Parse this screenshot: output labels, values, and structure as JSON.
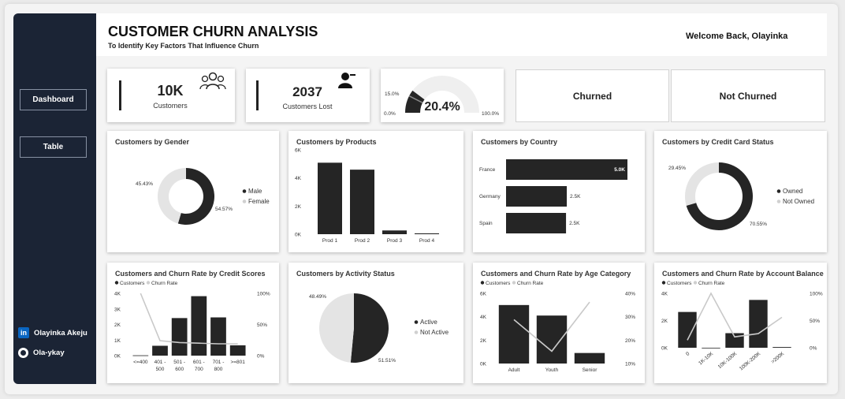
{
  "header": {
    "title": "CUSTOMER CHURN ANALYSIS",
    "subtitle": "To Identify Key Factors That Influence Churn",
    "welcome": "Welcome Back, Olayinka"
  },
  "sidebar": {
    "nav": [
      {
        "label": "Dashboard"
      },
      {
        "label": "Table"
      }
    ],
    "links": [
      {
        "icon": "linkedin-icon",
        "label": "Olayinka Akeju"
      },
      {
        "icon": "github-icon",
        "label": "Ola-ykay"
      }
    ]
  },
  "kpis": {
    "customers": {
      "value": "10K",
      "label": "Customers"
    },
    "lost": {
      "value": "2037",
      "label": "Customers Lost"
    },
    "gauge": {
      "value": "20.4%",
      "min": "0.0%",
      "max": "100.0%",
      "target": "15.0%",
      "fraction": 0.204,
      "target_fraction": 0.15
    }
  },
  "slicers": {
    "churned": "Churned",
    "not_churned": "Not Churned"
  },
  "colors": {
    "primary": "#252525",
    "light": "#e4e4e4",
    "line": "#c9c9c9",
    "sidebar": "#1b2435"
  },
  "chart_data": [
    {
      "id": "gender",
      "type": "pie",
      "title": "Customers by Gender",
      "legend": [
        "Male",
        "Female"
      ],
      "values": [
        54.57,
        45.43
      ],
      "labels": [
        "54.57%",
        "45.43%"
      ]
    },
    {
      "id": "products",
      "type": "bar",
      "title": "Customers by Products",
      "categories": [
        "Prod 1",
        "Prod 2",
        "Prod 3",
        "Prod 4"
      ],
      "values": [
        5084,
        4590,
        266,
        60
      ],
      "yticks": [
        "6K",
        "4K",
        "2K",
        "0K"
      ],
      "ylim": [
        0,
        6000
      ]
    },
    {
      "id": "country",
      "type": "bar",
      "title": "Customers by Country",
      "categories": [
        "France",
        "Germany",
        "Spain"
      ],
      "values": [
        5014,
        2509,
        2477
      ],
      "labels": [
        "5.0K",
        "2.5K",
        "2.5K"
      ]
    },
    {
      "id": "credit_card",
      "type": "pie",
      "title": "Customers by Credit Card Status",
      "legend": [
        "Owned",
        "Not Owned"
      ],
      "values": [
        70.55,
        29.45
      ],
      "labels": [
        "70.55%",
        "29.45%"
      ]
    },
    {
      "id": "credit_scores",
      "type": "bar",
      "title": "Customers and Churn Rate by Credit Scores",
      "legend": [
        "Customers",
        "Churn Rate"
      ],
      "categories": [
        "<=400",
        "401 - 500",
        "501 - 600",
        "601 - 700",
        "701 - 800",
        ">=801"
      ],
      "values": [
        19,
        633,
        2412,
        3818,
        2455,
        663
      ],
      "churn_rate": [
        100,
        24,
        21,
        20,
        19,
        19
      ],
      "yticks": [
        "4K",
        "3K",
        "2K",
        "1K",
        "0K"
      ],
      "ylim": [
        0,
        4000
      ],
      "y2ticks": [
        "100%",
        "50%",
        "0%"
      ]
    },
    {
      "id": "activity",
      "type": "pie",
      "title": "Customers by Activity Status",
      "legend": [
        "Active",
        "Not Active"
      ],
      "values": [
        51.51,
        48.49
      ],
      "labels": [
        "51.51%",
        "48.49%"
      ]
    },
    {
      "id": "age",
      "type": "bar",
      "title": "Customers and Churn Rate by Age Category",
      "legend": [
        "Customers",
        "Churn Rate"
      ],
      "categories": [
        "Adult",
        "Youth",
        "Senior"
      ],
      "values": [
        5000,
        4100,
        900
      ],
      "churn_rate": [
        25,
        7,
        35
      ],
      "yticks": [
        "6K",
        "4K",
        "2K",
        "0K"
      ],
      "ylim": [
        0,
        6000
      ],
      "y2ticks": [
        "40%",
        "30%",
        "20%",
        "10%"
      ]
    },
    {
      "id": "balance",
      "type": "bar",
      "title": "Customers and Churn Rate by Account Balance",
      "legend": [
        "Customers",
        "Churn Rate"
      ],
      "categories": [
        "0",
        "1K-10K",
        "10K-100K",
        "100K-200K",
        ">200K"
      ],
      "values": [
        3617,
        2,
        1474,
        4834,
        73
      ],
      "churn_rate": [
        14,
        100,
        20,
        26,
        56
      ],
      "yticks": [
        "4K",
        "2K",
        "0K"
      ],
      "ylim": [
        0,
        5500
      ],
      "y2ticks": [
        "100%",
        "50%",
        "0%"
      ]
    }
  ]
}
